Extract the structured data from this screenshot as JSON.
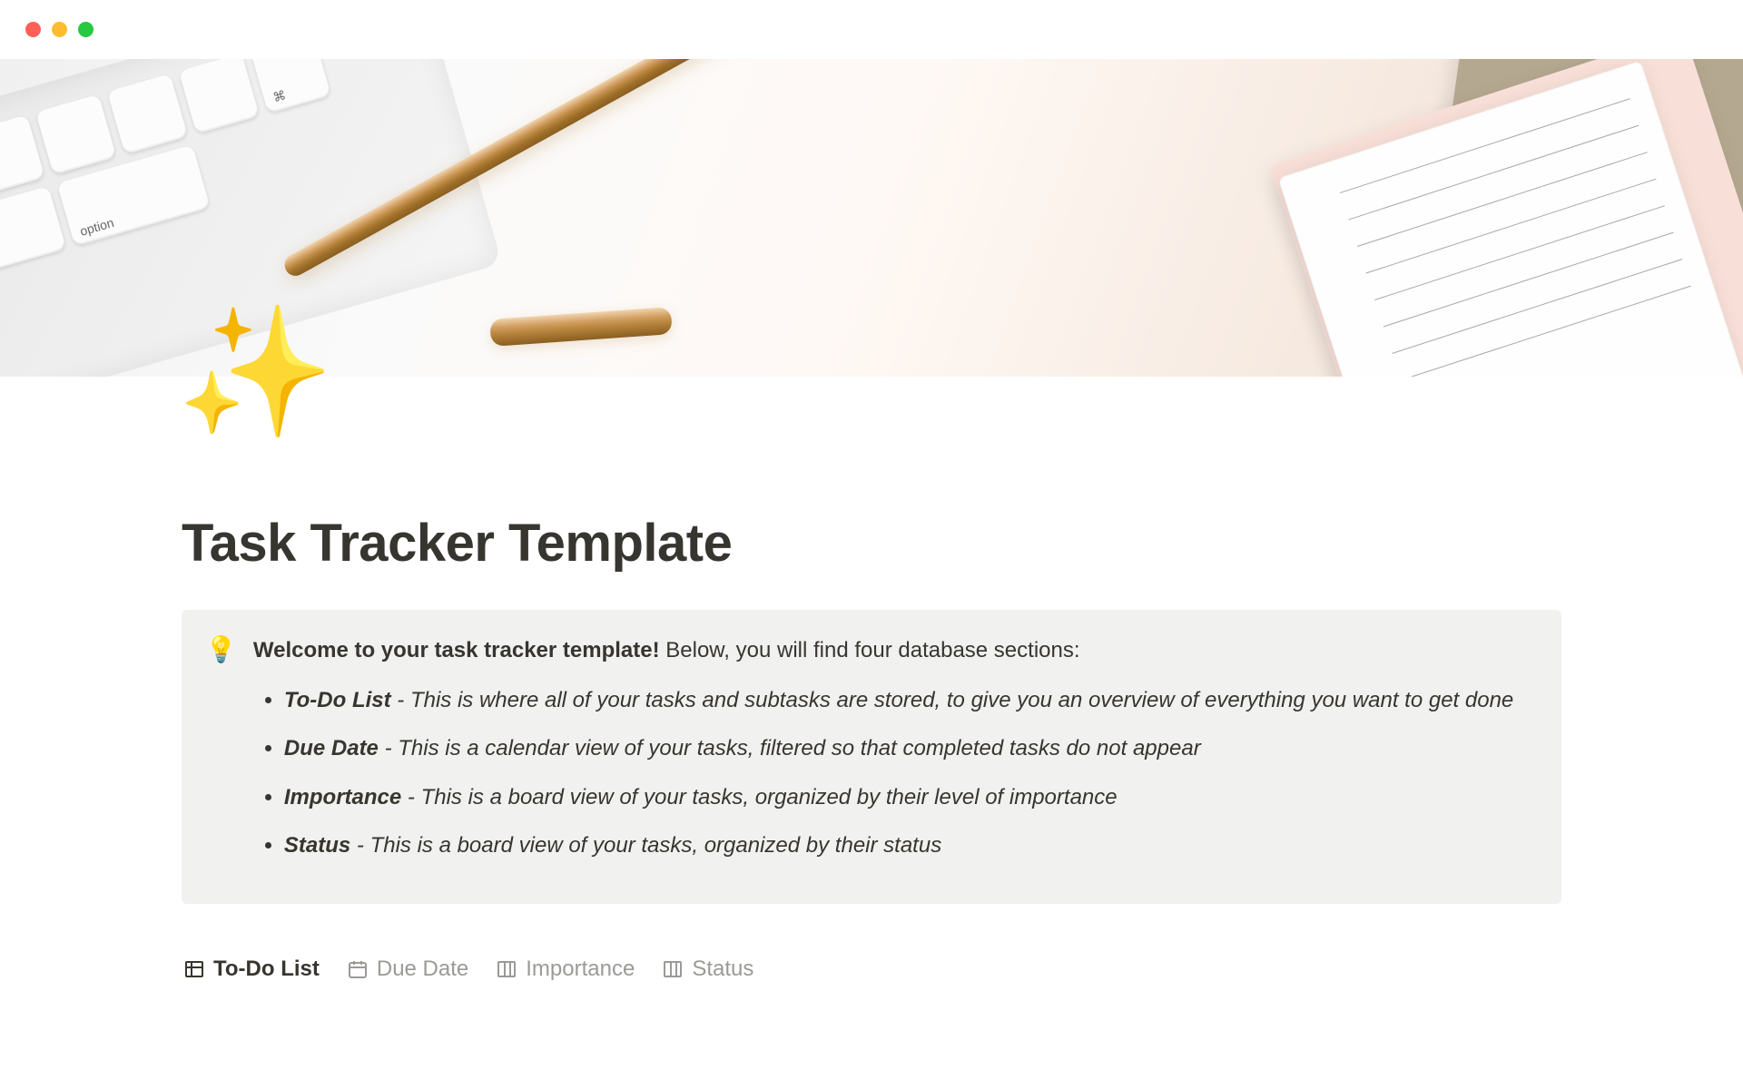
{
  "page": {
    "title": "Task Tracker Template",
    "icon": "✨"
  },
  "callout": {
    "icon": "💡",
    "lead_strong": "Welcome to your task tracker template!",
    "lead_rest": " Below, you will find four database sections:",
    "items": [
      {
        "label": "To-Do List",
        "desc": " - This is where all of your tasks and subtasks are stored, to give you an overview of everything you want to get done"
      },
      {
        "label": "Due Date",
        "desc": " - This is a calendar view of your tasks, filtered so that completed tasks do not appear"
      },
      {
        "label": "Importance",
        "desc": " - This is a board view of your tasks, organized by their level of importance"
      },
      {
        "label": "Status",
        "desc": " - This is a board view of your tasks, organized by their status"
      }
    ]
  },
  "tabs": [
    {
      "label": "To-Do List",
      "icon": "table",
      "active": true
    },
    {
      "label": "Due Date",
      "icon": "calendar",
      "active": false
    },
    {
      "label": "Importance",
      "icon": "board",
      "active": false
    },
    {
      "label": "Status",
      "icon": "board",
      "active": false
    }
  ],
  "keyboard_keys": [
    "",
    "",
    "",
    "",
    "",
    "⌘",
    "command",
    "option"
  ]
}
